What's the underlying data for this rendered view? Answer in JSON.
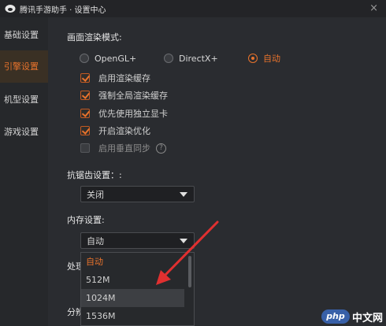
{
  "window": {
    "title": "腾讯手游助手 · 设置中心",
    "close_glyph": "×"
  },
  "sidebar": {
    "items": [
      {
        "label": "基础设置",
        "active": false
      },
      {
        "label": "引擎设置",
        "active": true
      },
      {
        "label": "机型设置",
        "active": false
      },
      {
        "label": "游戏设置",
        "active": false
      }
    ]
  },
  "render_mode": {
    "title": "画面渲染模式:",
    "options": [
      "OpenGL+",
      "DirectX+",
      "自动"
    ],
    "selected": "自动"
  },
  "checkboxes": [
    {
      "label": "启用渲染缓存",
      "checked": true
    },
    {
      "label": "强制全局渲染缓存",
      "checked": true
    },
    {
      "label": "优先使用独立显卡",
      "checked": true
    },
    {
      "label": "开启渲染优化",
      "checked": true
    },
    {
      "label": "启用垂直同步",
      "checked": false,
      "help": "?"
    }
  ],
  "antialias": {
    "title": "抗锯齿设置：:",
    "value": "关闭"
  },
  "memory": {
    "title": "内存设置:",
    "value": "自动",
    "options": [
      "自动",
      "512M",
      "1024M",
      "1536M"
    ],
    "highlighted": "1024M"
  },
  "partial_labels": {
    "processor": "处理",
    "resolution": "分辨"
  },
  "watermark": {
    "logo": "php",
    "text": "中文网"
  },
  "colors": {
    "accent": "#e8732c",
    "background": "#2a2c30",
    "sidebar": "#26282b",
    "arrow": "#e03030"
  }
}
